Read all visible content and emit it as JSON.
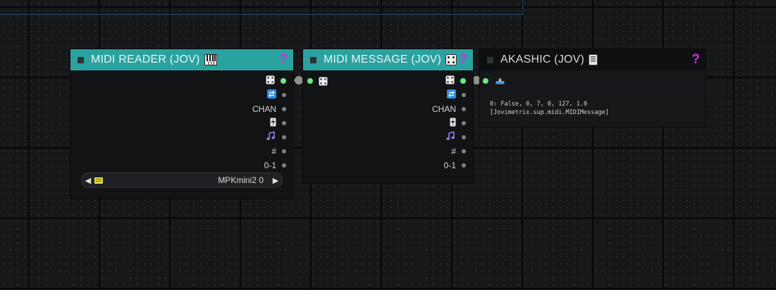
{
  "colors": {
    "teal_header": "#2aa3a0",
    "help": "#d030e0",
    "connected_dot": "#6ce88a"
  },
  "nodes": {
    "midi_reader": {
      "title": "MIDI READER (JOV)",
      "title_icon": "piano-icon",
      "help": "?",
      "outputs": [
        {
          "label": "",
          "icon": "dice-icon",
          "connected": true
        },
        {
          "label": "",
          "icon": "swap-icon",
          "connected": false
        },
        {
          "label": "CHAN",
          "icon": "",
          "connected": false
        },
        {
          "label": "",
          "icon": "fader-icon",
          "connected": false
        },
        {
          "label": "",
          "icon": "music-note-icon",
          "connected": false
        },
        {
          "label": "#",
          "icon": "",
          "connected": false
        },
        {
          "label": "0-1",
          "icon": "",
          "connected": false
        }
      ],
      "device": {
        "prev": "◀",
        "next": "▶",
        "value": "MPKmini2 0",
        "icon": "keyboard-icon"
      }
    },
    "midi_message": {
      "title": "MIDI MESSAGE (JOV)",
      "title_icon": "dice-icon",
      "help": "?",
      "input_icon": "dice-icon",
      "outputs": [
        {
          "label": "",
          "icon": "dice-icon",
          "connected": true
        },
        {
          "label": "",
          "icon": "swap-icon",
          "connected": false
        },
        {
          "label": "CHAN",
          "icon": "",
          "connected": false
        },
        {
          "label": "",
          "icon": "fader-icon",
          "connected": false
        },
        {
          "label": "",
          "icon": "music-note-icon",
          "connected": false
        },
        {
          "label": "#",
          "icon": "",
          "connected": false
        },
        {
          "label": "0-1",
          "icon": "",
          "connected": false
        }
      ]
    },
    "akashic": {
      "title": "AKASHIC (JOV)",
      "title_icon": "book-icon",
      "help": "?",
      "input_icon": "inbox-icon",
      "preview_line1": "0: False, 0, 7, 0, 127, 1.0",
      "preview_line2": "[Jovimetrix.sup.midi.MIDIMessage]"
    }
  }
}
